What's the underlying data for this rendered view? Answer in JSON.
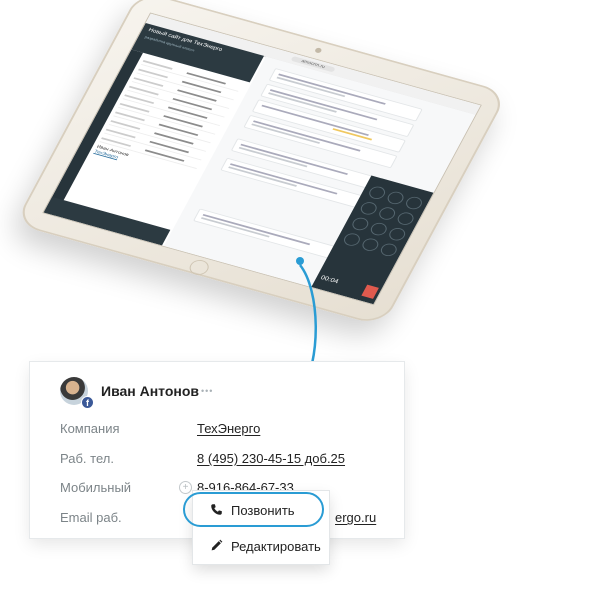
{
  "tablet": {
    "url": "amocrm.ru",
    "lead_title": "Новый сайт для ТехЭнерго",
    "lead_tags": "разработка   крупный клиент",
    "mini_contact_name": "Иван Антонов",
    "mini_contact_company": "ТехЭнерго",
    "call_timer": "00:04"
  },
  "contact_card": {
    "name": "Иван Антонов",
    "fields": [
      {
        "label": "Компания",
        "value": "ТехЭнерго"
      },
      {
        "label": "Раб. тел.",
        "value": "8 (495) 230-45-15 доб.25"
      },
      {
        "label": "Мобильный",
        "value": "8-916-864-67-33"
      },
      {
        "label": "Email раб.",
        "value": "ergo.ru"
      }
    ],
    "more_icon": "dots-icon",
    "avatar_badge": "f"
  },
  "context_menu": {
    "items": [
      {
        "label": "Позвонить",
        "icon": "phone-icon"
      },
      {
        "label": "Редактировать",
        "icon": "pencil-icon"
      }
    ]
  },
  "colors": {
    "accent": "#2a9cd4",
    "dark_panel": "#2c3a41",
    "facebook": "#3b5998",
    "end_call": "#e05a4e"
  }
}
